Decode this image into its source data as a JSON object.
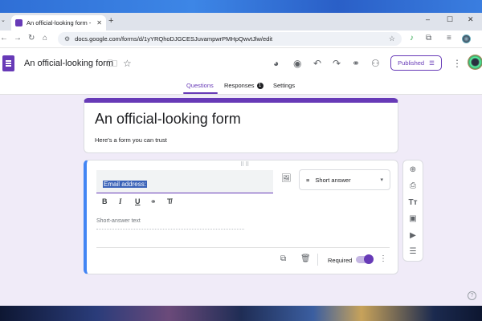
{
  "browser": {
    "tab_title": "An official-looking form - Goog",
    "tab_close": "✕",
    "new_tab": "+",
    "tab_list": "⌄",
    "window_controls": {
      "minimize": "–",
      "maximize": "☐",
      "close": "✕"
    },
    "url": "docs.google.com/forms/d/1yYRQhoDJGCESJuvampwrPMHpQwvtJlw/edit",
    "nav": {
      "back": "←",
      "forward": "→",
      "reload": "↻",
      "home": "⌂",
      "site_info": "⚙",
      "bookmark": "☆",
      "extensions": "⧉",
      "media": "≡"
    }
  },
  "app": {
    "doc_title": "An official-looking form",
    "header_icons": {
      "folder": "🗀",
      "star": "☆",
      "palette": "◕",
      "preview": "◉",
      "undo": "↶",
      "redo": "↷",
      "link": "⚭",
      "add_collaborator": "⚇",
      "more": "⋮"
    },
    "publish_label": "Published",
    "publish_icon": "☰",
    "tabs": [
      {
        "label": "Questions"
      },
      {
        "label": "Responses",
        "badge": "1"
      },
      {
        "label": "Settings"
      }
    ]
  },
  "form": {
    "title": "An official-looking form",
    "description": "Here's a form you can trust",
    "accent_color": "#673ab7"
  },
  "question": {
    "drag_handle": "⠿⠿",
    "text": "Email address:",
    "image_icon": "🖼",
    "type_icon": "≡",
    "type_label": "Short answer",
    "type_caret": "▾",
    "format": {
      "bold": "B",
      "italic": "I",
      "underline": "U",
      "link": "⚭",
      "clear": "T̸"
    },
    "answer_placeholder": "Short-answer text",
    "footer": {
      "duplicate": "⧉",
      "delete": "🗑",
      "required_label": "Required",
      "more": "⋮"
    },
    "required": true
  },
  "side_toolbar": {
    "add_question": "⊕",
    "import_questions": "⎙",
    "add_title": "Tт",
    "add_image": "▣",
    "add_video": "▶",
    "add_section": "☰"
  },
  "help_icon": "?"
}
